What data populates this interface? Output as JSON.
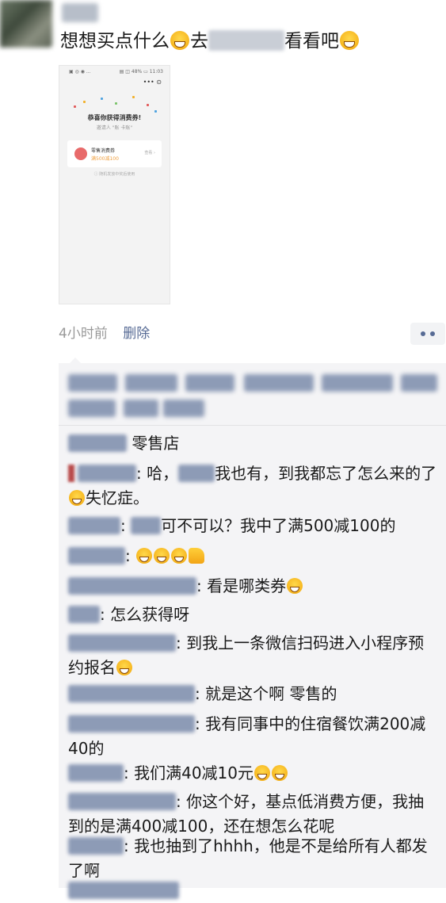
{
  "post": {
    "text_before": "想想买点什么",
    "text_mid": "去",
    "text_after": "看看吧",
    "time": "4小时前",
    "delete_label": "删除"
  },
  "screenshot": {
    "status_left": "▣ ◎ ◉ ...",
    "status_right": "▤ ◫ 48% ▭ 11:03",
    "menu": "••• ⊙",
    "title": "恭喜你获得消费券!",
    "subtitle": "邀请人 \"账 卡账\"",
    "coupon_name": "零售消费券",
    "coupon_sub": "满500减100",
    "coupon_btn": "查看 ›",
    "note": "ⓘ 随机发放中奖后使用"
  },
  "comments": [
    {
      "text": "零售店"
    },
    {
      "text_a": "哈，",
      "text_b": "我也有，到我都忘了怎么来的了",
      "text_c": "失忆症。"
    },
    {
      "text_a": "可不可以？我中了满500减100的"
    },
    {
      "text": ""
    },
    {
      "text": "看是哪类券"
    },
    {
      "text": "怎么获得呀"
    },
    {
      "text": "到我上一条微信扫码进入小程序预约报名"
    },
    {
      "text": "就是这个啊 零售的"
    },
    {
      "text": "我有同事中的住宿餐饮满200减40的"
    },
    {
      "text": "我们满40减10元"
    },
    {
      "text": "你这个好，基点低消费方便，我抽到的是满400减100，还在想怎么花呢"
    },
    {
      "text": "我也抽到了hhhh，他是不是给所有人都发了啊"
    }
  ],
  "icons": {
    "laugh": "laughing-tears-emoji",
    "grin": "grinning-emoji",
    "think": "thinking-emoji",
    "thumb": "thumbs-up-emoji"
  },
  "colors": {
    "link": "#576b95",
    "meta": "#999999",
    "comment_bg": "#f4f4f6"
  }
}
